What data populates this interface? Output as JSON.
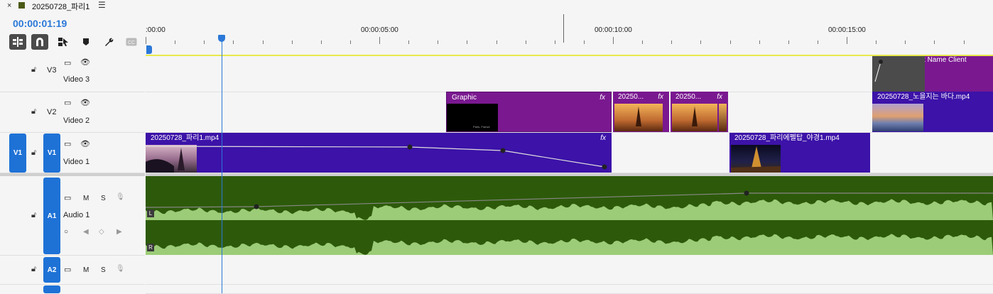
{
  "tab": {
    "close": "×",
    "title": "20250728_파리1",
    "menu_icon": "hamburger-menu-icon"
  },
  "timecode": "00:00:01:19",
  "toolbar": [
    "insert-sequence-icon",
    "snap-magnet-icon",
    "linked-selection-icon",
    "add-marker-icon",
    "settings-wrench-icon",
    "captions-icon"
  ],
  "ruler": {
    "labels": [
      ":00:00",
      "00:00:05:00",
      "00:00:10:00",
      "00:00:15:00"
    ]
  },
  "tracks": {
    "v3": {
      "id": "V3",
      "name": "Video 3"
    },
    "v2": {
      "id": "V2",
      "name": "Video 2"
    },
    "v1": {
      "src": "V1",
      "id": "V1",
      "name": "Video 1"
    },
    "a1": {
      "id": "A1",
      "name": "Audio 1",
      "m": "M",
      "s": "S",
      "ch_left": "L",
      "ch_right": "R"
    },
    "a2": {
      "id": "A2",
      "m": "M",
      "s": "S"
    }
  },
  "clips": {
    "v3_project": "Project:   Project Name Client",
    "v2_graphic": "Graphic",
    "v2_graphic_thumb_text": "Paris, France",
    "v2_clip2": "20250...",
    "v2_clip3": "20250...",
    "v2_clip4": "20250728_노을지는 바다.mp4",
    "v1_clip1": "20250728_파리1.mp4",
    "v1_clip2": "20250728_파리에펠탑_야경1.mp4",
    "fx": "fx"
  },
  "colors": {
    "accent": "#1e72d6",
    "clip_purple": "#3c12a8",
    "graphic_purple": "#7a1890",
    "audio_dark": "#2d5a0a",
    "audio_light": "#9ccc78",
    "work_area": "#e8e84a"
  }
}
